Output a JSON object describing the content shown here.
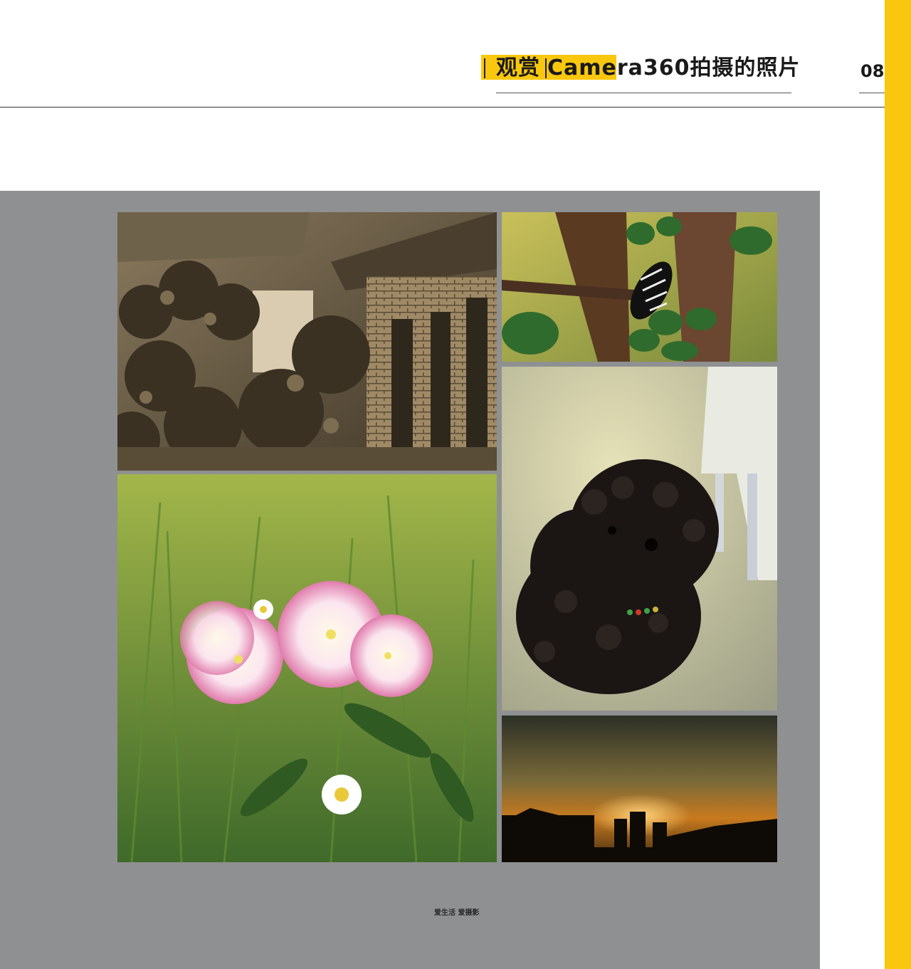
{
  "header": {
    "title_prefix": "观赏",
    "title_main": "Camera360拍摄的照片",
    "page_number": "08"
  },
  "footer": {
    "text": "爱生活 爱摄影"
  },
  "colors": {
    "accent": "#f9c80e",
    "panel": "#8f9091"
  }
}
